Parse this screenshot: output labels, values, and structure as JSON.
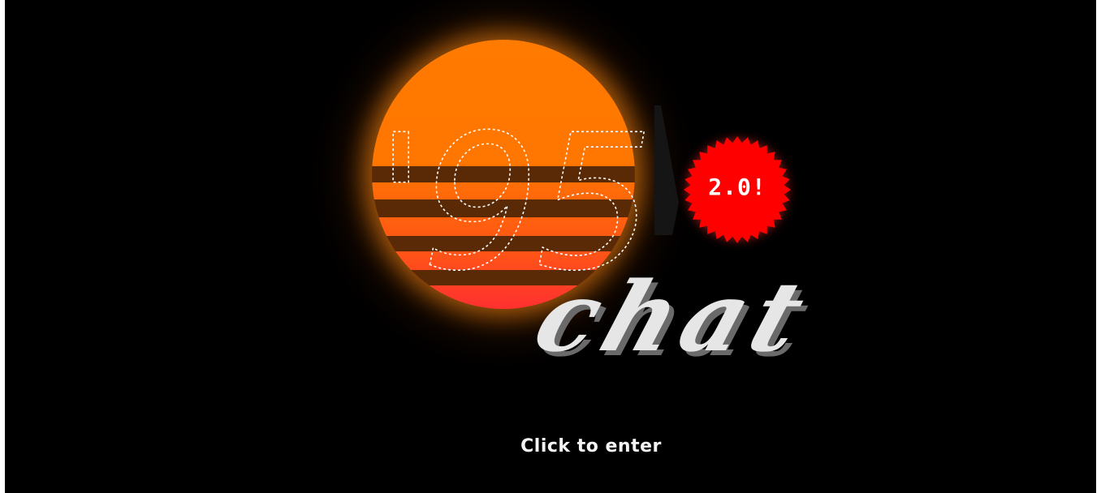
{
  "logo": {
    "prefix_text": "'95",
    "word_text": "chat",
    "version_badge": "2.0!"
  },
  "entry": {
    "prompt_label": "Click to enter"
  },
  "colors": {
    "background": "#000000",
    "sun_top": "#ff7a00",
    "sun_bottom": "#ff3030",
    "badge": "#ff0000",
    "text": "#ffffff"
  }
}
